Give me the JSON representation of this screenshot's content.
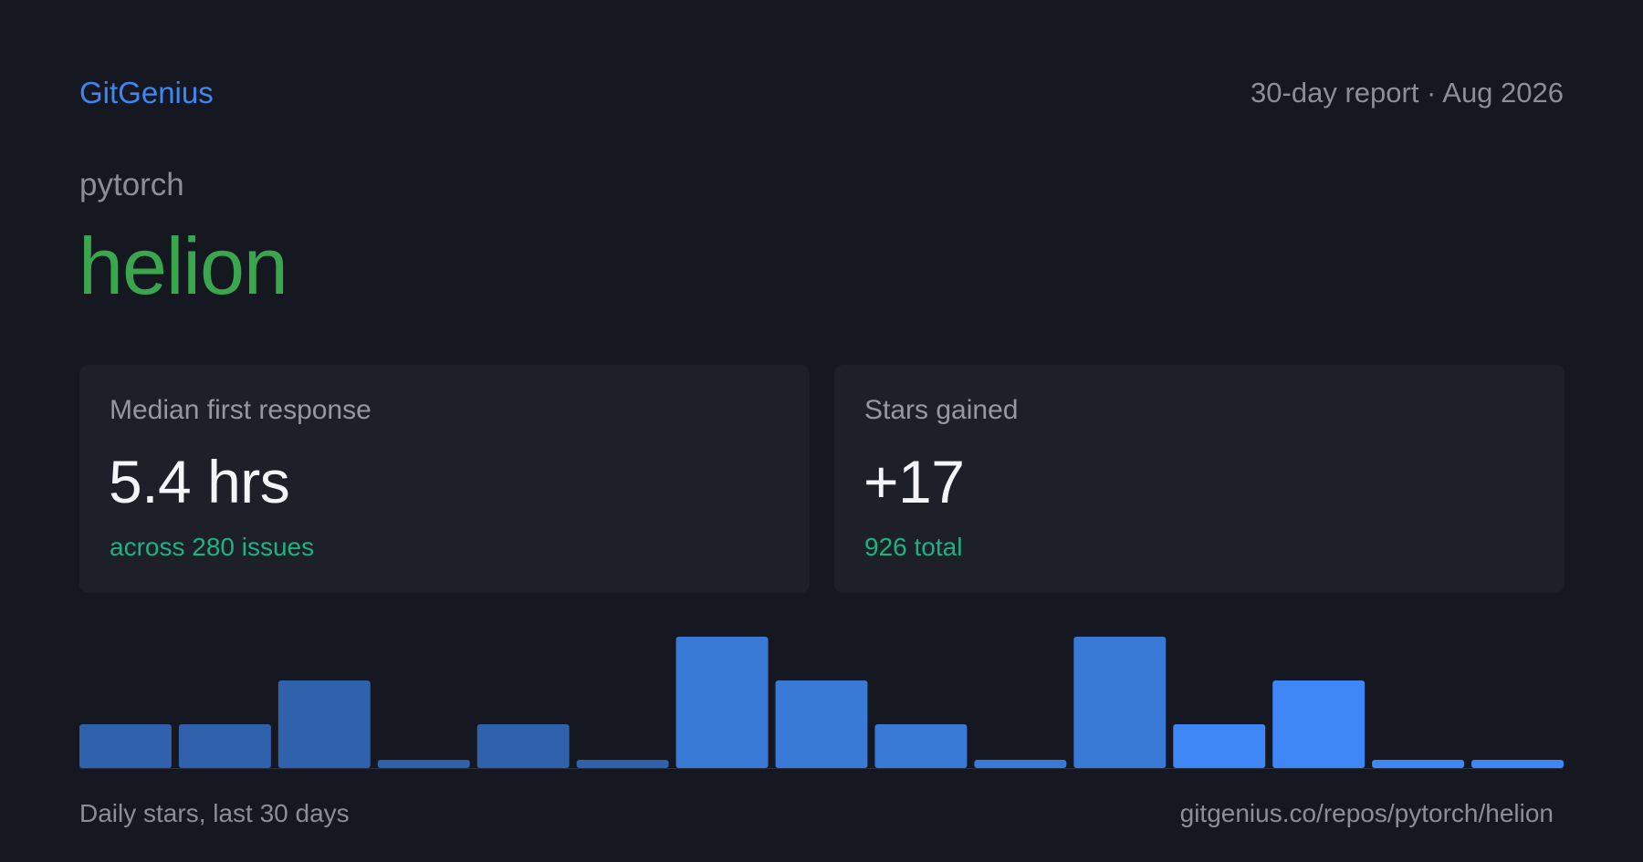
{
  "header": {
    "brand": "GitGenius",
    "report_meta": "30-day report · Aug 2026"
  },
  "repo": {
    "owner": "pytorch",
    "name": "helion"
  },
  "cards": [
    {
      "label": "Median first response",
      "value": "5.4 hrs",
      "sub": "across 280 issues"
    },
    {
      "label": "Stars gained",
      "value": "+17",
      "sub": "926 total"
    }
  ],
  "footer": {
    "caption": "Daily stars, last 30 days",
    "url": "gitgenius.co/repos/pytorch/helion"
  },
  "colors": {
    "brand": "#3f86f2",
    "repo_name": "#3aa74f",
    "subtext_green": "#1fb27e",
    "bar_early": "#2f61ac",
    "bar_mid": "#387ad6",
    "bar_late": "#3f86f6"
  },
  "chart_data": {
    "type": "bar",
    "values": [
      1,
      1,
      2,
      0,
      1,
      0,
      3,
      2,
      1,
      0,
      3,
      1,
      2,
      0,
      0
    ],
    "ylim": [
      0,
      3
    ],
    "grid": false,
    "legend": "none"
  }
}
